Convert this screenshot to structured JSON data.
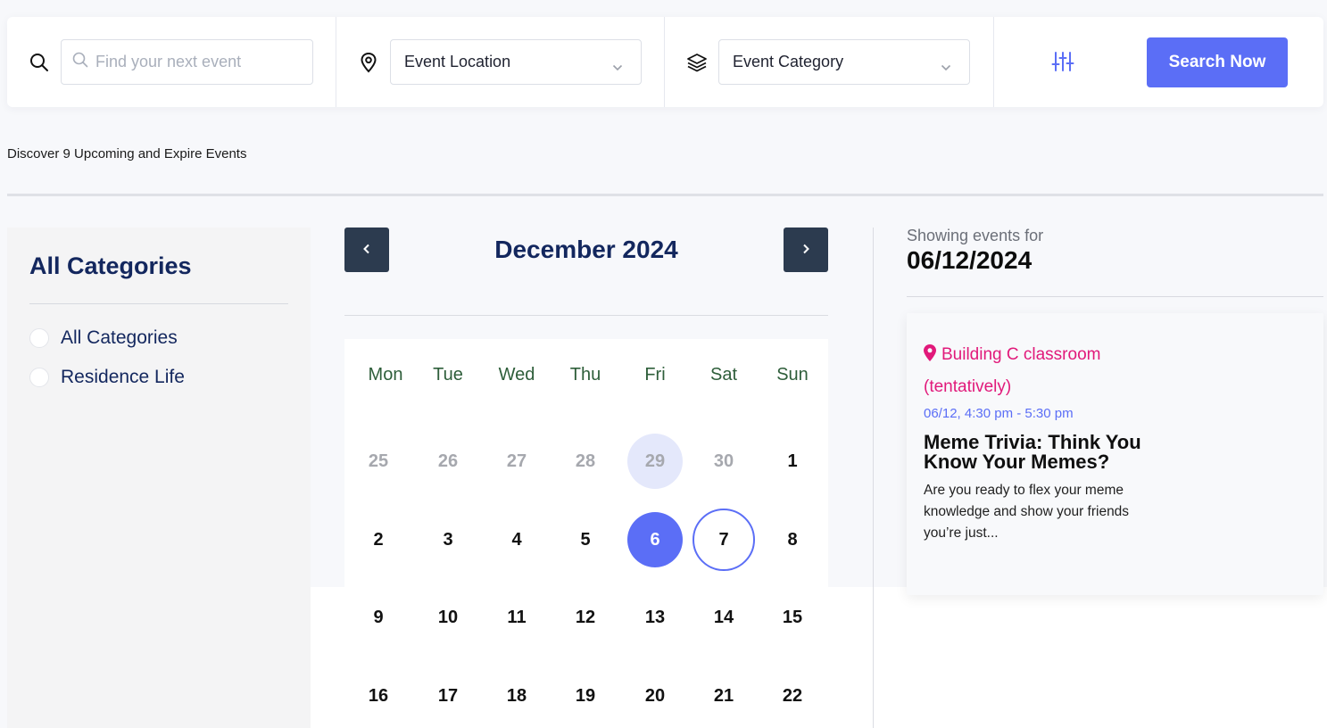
{
  "search": {
    "keyword_placeholder": "Find your next event",
    "location_label": "Event Location",
    "category_label": "Event Category",
    "button_label": "Search Now"
  },
  "discover_text": "Discover 9 Upcoming and Expire Events",
  "sidebar": {
    "title": "All Categories",
    "items": [
      {
        "label": "All Categories"
      },
      {
        "label": "Residence Life"
      }
    ]
  },
  "calendar": {
    "title": "December 2024",
    "weekdays": [
      "Mon",
      "Tue",
      "Wed",
      "Thu",
      "Fri",
      "Sat",
      "Sun"
    ],
    "weeks": [
      [
        {
          "d": "25",
          "muted": true
        },
        {
          "d": "26",
          "muted": true
        },
        {
          "d": "27",
          "muted": true
        },
        {
          "d": "28",
          "muted": true
        },
        {
          "d": "29",
          "muted": true,
          "has_event": true
        },
        {
          "d": "30",
          "muted": true
        },
        {
          "d": "1"
        }
      ],
      [
        {
          "d": "2"
        },
        {
          "d": "3"
        },
        {
          "d": "4"
        },
        {
          "d": "5"
        },
        {
          "d": "6",
          "selected": true
        },
        {
          "d": "7",
          "today": true
        },
        {
          "d": "8"
        }
      ],
      [
        {
          "d": "9"
        },
        {
          "d": "10"
        },
        {
          "d": "11"
        },
        {
          "d": "12"
        },
        {
          "d": "13"
        },
        {
          "d": "14"
        },
        {
          "d": "15"
        }
      ],
      [
        {
          "d": "16"
        },
        {
          "d": "17"
        },
        {
          "d": "18"
        },
        {
          "d": "19"
        },
        {
          "d": "20"
        },
        {
          "d": "21"
        },
        {
          "d": "22"
        }
      ]
    ]
  },
  "events_panel": {
    "showing_label": "Showing events for",
    "date": "06/12/2024",
    "event": {
      "location_line1": "Building C classroom",
      "location_line2": "(tentatively)",
      "time": "06/12, 4:30 pm - 5:30 pm",
      "title": "Meme Trivia: Think You Know Your Memes?",
      "description": "Are you ready to flex your meme knowledge and show your friends you’re just..."
    }
  },
  "colors": {
    "accent": "#5b6ef6",
    "navy": "#13275e",
    "nav_button": "#2c3b4f",
    "location_pink": "#e1197a",
    "weekday_green": "#2e5e3a"
  },
  "icons": {
    "keyword": "search-icon",
    "location": "map-pin-icon",
    "category": "layers-icon",
    "filter": "sliders-icon",
    "dropdown": "chevron-down-icon"
  }
}
